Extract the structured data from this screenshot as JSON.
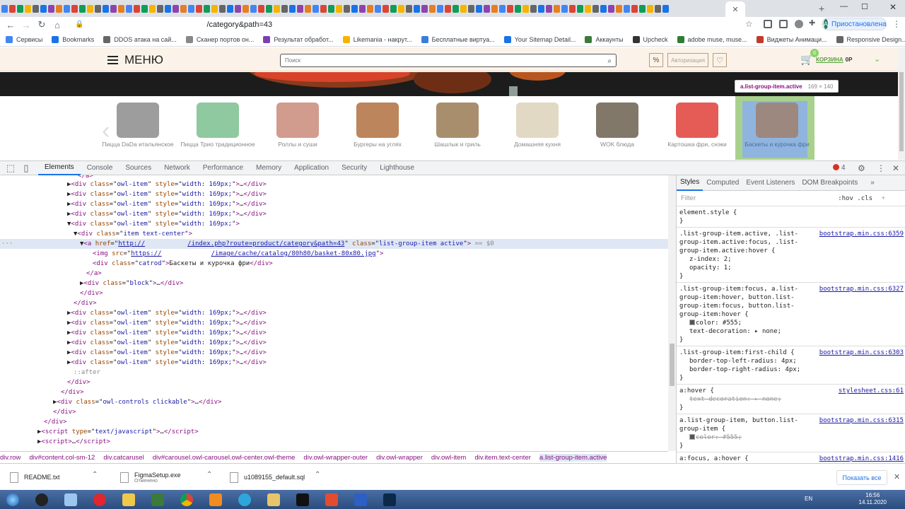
{
  "browser": {
    "url_suffix": "/category&path=43",
    "profile_label": "Приостановлена",
    "profile_initial": "A"
  },
  "bookmarks": [
    {
      "label": "Сервисы",
      "color": "#4285f4"
    },
    {
      "label": "Bookmarks",
      "color": "#1a73e8"
    },
    {
      "label": "DDOS атака на сай...",
      "color": "#666"
    },
    {
      "label": "Сканер портов он...",
      "color": "#888"
    },
    {
      "label": "Результат обработ...",
      "color": "#7b3fb4"
    },
    {
      "label": "Likemania - накрут...",
      "color": "#f4b400"
    },
    {
      "label": "Бесплатные виртуа...",
      "color": "#3b7dd8"
    },
    {
      "label": "Your Sitemap Detail...",
      "color": "#1a73e8"
    },
    {
      "label": "Аккаунты",
      "color": "#3c7a3c"
    },
    {
      "label": "Upcheck",
      "color": "#333"
    },
    {
      "label": "adobe muse, muse...",
      "color": "#2e7d32"
    },
    {
      "label": "Виджеты Анимаци...",
      "color": "#c0392b"
    },
    {
      "label": "Responsive Design...",
      "color": "#666"
    }
  ],
  "site": {
    "menu_label": "МЕНЮ",
    "search_placeholder": "Поиск",
    "discount_icon": "%",
    "auth_label": "Авторизация",
    "cart_label": "КОРЗИНА",
    "cart_sum": "0Р",
    "cart_count": "0"
  },
  "categories": [
    {
      "label": "Пицца DaDa итальянское"
    },
    {
      "label": "Пицца Трио традиционное"
    },
    {
      "label": "Роллы и суши"
    },
    {
      "label": "Бургеры на углях"
    },
    {
      "label": "Шашлык и гриль"
    },
    {
      "label": "Домашняя кухня"
    },
    {
      "label": "WOK блюда"
    },
    {
      "label": "Картошка фри, снэки"
    },
    {
      "label": "Баскеты и курочка фри"
    }
  ],
  "tooltip": {
    "selector": "a.list-group-item.active",
    "size": "169 × 140"
  },
  "devtools": {
    "tabs": [
      "Elements",
      "Console",
      "Sources",
      "Network",
      "Performance",
      "Memory",
      "Application",
      "Security",
      "Lighthouse"
    ],
    "error_count": "4"
  },
  "dom": {
    "owl_class": "owl-item",
    "owl_style": "width: 169px;",
    "item_class": "item text-center",
    "href": "http://",
    "href_rest": "/index.php?route=product/category&path=43",
    "a_class": "list-group-item active",
    "dollar": "== $0",
    "img_src": "https://",
    "img_rest": "/image/cache/catalog/80h80/basket-80x80.jpg",
    "catrod_text": "Баскеты и курочка фри",
    "block_class": "block",
    "controls_class": "owl-controls clickable",
    "script_type": "text/javascript",
    "after": "::after"
  },
  "styles": {
    "tabs": [
      "Styles",
      "Computed",
      "Event Listeners",
      "DOM Breakpoints"
    ],
    "filter_placeholder": "Filter",
    "hov": ":hov  .cls",
    "rules": [
      {
        "selector": "element.style {",
        "src": "",
        "props": []
      },
      {
        "selector": ".list-group-item.active, .list-group-item.active:focus, .list-group-item.active:hover {",
        "src": "bootstrap.min.css:6359",
        "props": [
          "z-index: 2;",
          "opacity: 1;"
        ]
      },
      {
        "selector": ".list-group-item:focus, a.list-group-item:hover, button.list-group-item:focus, button.list-group-item:hover {",
        "src": "bootstrap.min.css:6327",
        "props": [
          "color: #555;",
          "text-decoration: ▸ none;"
        ]
      },
      {
        "selector": ".list-group-item:first-child {",
        "src": "bootstrap.min.css:6303",
        "props": [
          "border-top-left-radius: 4px;",
          "border-top-right-radius: 4px;"
        ]
      },
      {
        "selector": "a:hover {",
        "src": "stylesheet.css:61",
        "props": [
          "text-decoration: ▸ none;"
        ],
        "strike": true
      },
      {
        "selector": "a.list-group-item, button.list-group-item {",
        "src": "bootstrap.min.css:6315",
        "props": [
          "color: #555;"
        ],
        "strike": true
      },
      {
        "selector": "a:focus, a:hover {",
        "src": "bootstrap.min.css:1416",
        "props": []
      }
    ]
  },
  "breadcrumbs": [
    "div.row",
    "div#content.col-sm-12",
    "div.catcarusel",
    "div#carousel.owl-carousel.owl-center.owl-theme",
    "div.owl-wrapper-outer",
    "div.owl-wrapper",
    "div.owl-item",
    "div.item.text-center",
    "a.list-group-item.active"
  ],
  "downloads": [
    {
      "name": "README.txt",
      "sub": ""
    },
    {
      "name": "FigmaSetup.exe",
      "sub": "Отменено"
    },
    {
      "name": "u1089155_default.sql",
      "sub": ""
    }
  ],
  "downloads_show_all": "Показать все",
  "taskbar": {
    "lang": "EN",
    "time": "16:56",
    "date": "14.11.2020"
  }
}
